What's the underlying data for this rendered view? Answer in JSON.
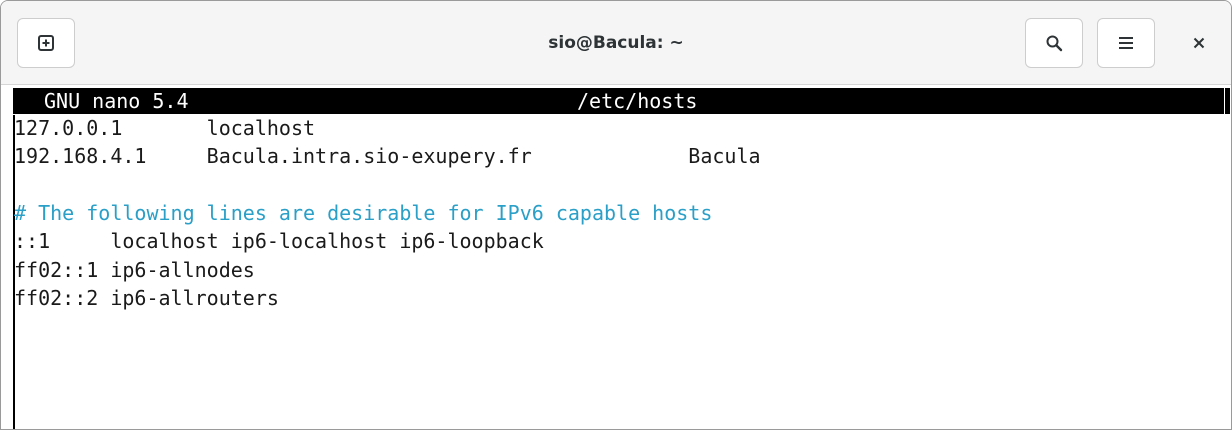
{
  "window": {
    "title": "sio@Bacula: ~"
  },
  "titlebar": {
    "new_tab_icon": "new-tab-icon",
    "search_icon": "search-icon",
    "menu_icon": "hamburger-menu-icon",
    "close_icon": "close-icon"
  },
  "nano": {
    "version": "GNU nano 5.4",
    "filename": "/etc/hosts",
    "lines": [
      "127.0.0.1       localhost",
      "192.168.4.1     Bacula.intra.sio-exupery.fr             Bacula",
      "",
      "# The following lines are desirable for IPv6 capable hosts",
      "::1     localhost ip6-localhost ip6-loopback",
      "ff02::1 ip6-allnodes",
      "ff02::2 ip6-allrouters"
    ]
  },
  "colors": {
    "comment": "#2a9fc7",
    "header_bg": "#000000",
    "header_fg": "#ffffff",
    "titlebar_bg": "#f5f5f5"
  }
}
